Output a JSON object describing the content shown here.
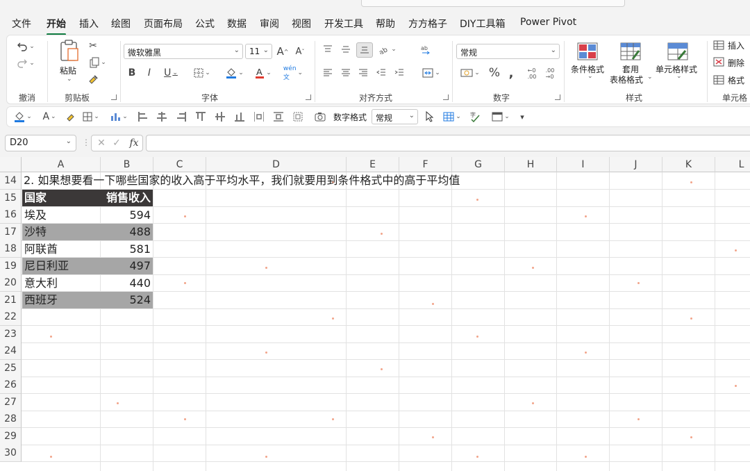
{
  "ribbon_tabs": [
    "文件",
    "开始",
    "插入",
    "绘图",
    "页面布局",
    "公式",
    "数据",
    "审阅",
    "视图",
    "开发工具",
    "帮助",
    "方方格子",
    "DIY工具箱",
    "Power Pivot"
  ],
  "active_tab": "开始",
  "groups": {
    "undo": "撤消",
    "clipboard": "剪贴板",
    "paste": "粘贴",
    "font": "字体",
    "alignment": "对齐方式",
    "number": "数字",
    "styles": "样式",
    "cells": "单元格"
  },
  "font": {
    "name": "微软雅黑",
    "size": "11"
  },
  "number_format": "常规",
  "styles_buttons": {
    "conditional": "条件格式",
    "table_1": "套用",
    "table_2": "表格格式",
    "cell_styles": "单元格样式"
  },
  "cells_buttons": {
    "insert": "插入",
    "delete": "删除",
    "format": "格式"
  },
  "qat": {
    "number_format_label": "数字格式",
    "number_format_value": "常规"
  },
  "name_box": "D20",
  "fx": "fx",
  "columns": [
    "A",
    "B",
    "C",
    "D",
    "E",
    "F",
    "G",
    "H",
    "I",
    "J",
    "K",
    "L"
  ],
  "rows": [
    "14",
    "15",
    "16",
    "17",
    "18",
    "19",
    "20",
    "21",
    "22",
    "23",
    "24",
    "25",
    "26",
    "27",
    "28",
    "29",
    "30"
  ],
  "sheet": {
    "note": "2. 如果想要看一下哪些国家的收入高于平均水平，我们就要用到条件格式中的高于平均值",
    "header": {
      "country": "国家",
      "sales": "销售收入"
    },
    "table": [
      {
        "country": "埃及",
        "sales": "594"
      },
      {
        "country": "沙特",
        "sales": "488"
      },
      {
        "country": "阿联酋",
        "sales": "581"
      },
      {
        "country": "尼日利亚",
        "sales": "497"
      },
      {
        "country": "意大利",
        "sales": "440"
      },
      {
        "country": "西班牙",
        "sales": "524"
      }
    ]
  },
  "colors": {
    "accent": "#107c41",
    "header_fill": "#3b3838",
    "band_fill": "#a6a6a6",
    "dot": "#f2a48a"
  }
}
